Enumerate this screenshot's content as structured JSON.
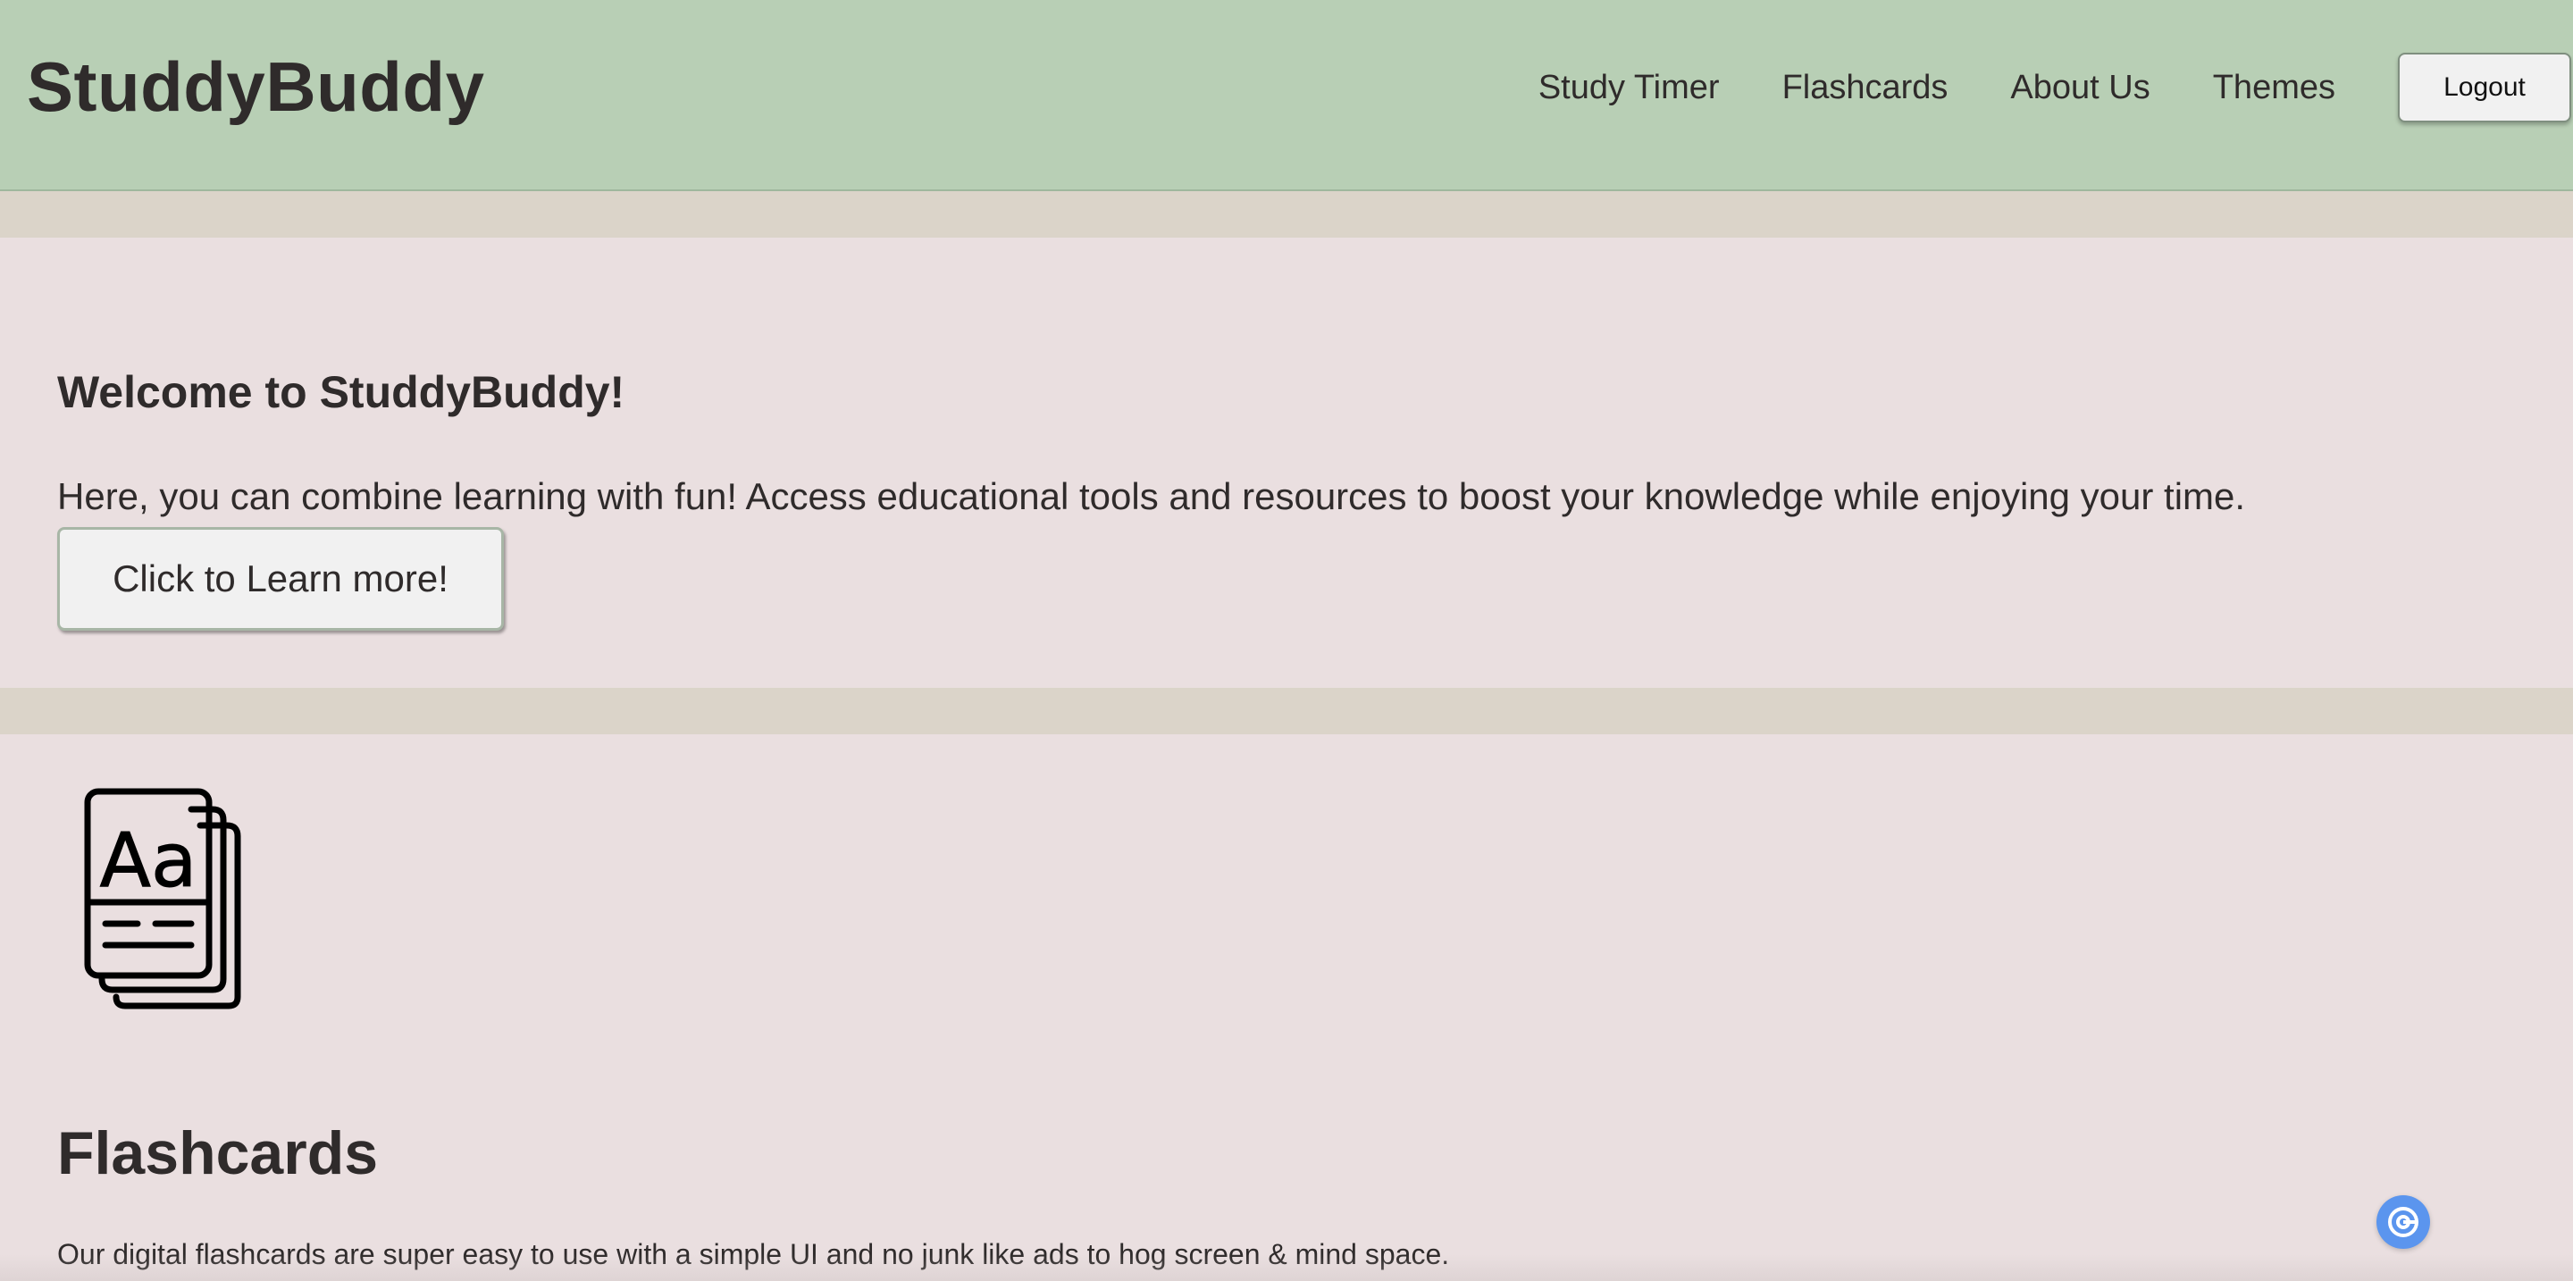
{
  "header": {
    "brand": "StuddyBuddy",
    "nav": [
      "Study Timer",
      "Flashcards",
      "About Us",
      "Themes"
    ],
    "logout_label": "Logout"
  },
  "welcome": {
    "title": "Welcome to StuddyBuddy!",
    "text": "Here, you can combine learning with fun! Access educational tools and resources to boost your knowledge while enjoying your time.",
    "button_label": "Click to Learn more!"
  },
  "flashcards": {
    "icon": "flashcards-icon",
    "title": "Flashcards",
    "text": "Our digital flashcards are super easy to use with a simple UI and no junk like ads to hog screen & mind space."
  },
  "floating_button": {
    "icon": "assistant-icon"
  },
  "colors": {
    "header_background": "#b8cfb5",
    "panel_background": "#eadfe0",
    "band_background": "#dbd4c9",
    "text": "#2f2b2b",
    "floating_button": "#5b95ee"
  }
}
